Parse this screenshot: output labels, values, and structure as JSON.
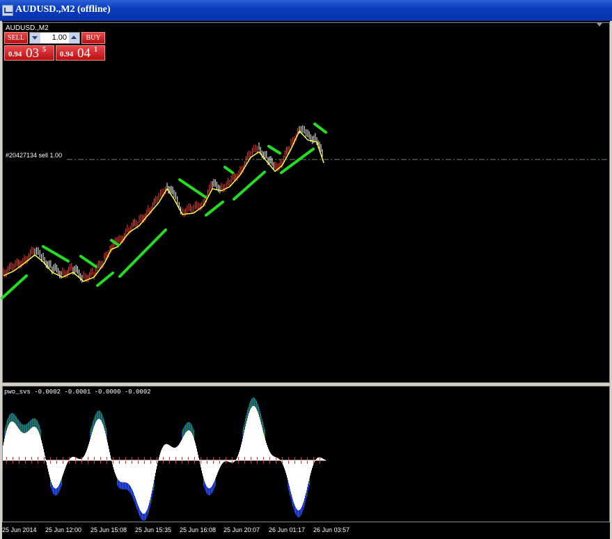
{
  "window": {
    "title": "AUDUSD.,M2 (offline)"
  },
  "chart": {
    "symbol_label": "AUDUSD.,M2"
  },
  "one_click": {
    "sell_label": "SELL",
    "buy_label": "BUY",
    "lot_value": "1.00",
    "sell_price": {
      "small": "0.94",
      "big": "03",
      "sup": "5"
    },
    "buy_price": {
      "small": "0.94",
      "big": "04",
      "sup": "1"
    }
  },
  "order": {
    "label": "#20427134 sell 1.00"
  },
  "indicator": {
    "label": "pwo_svs -0.0002 -0.0001 -0.0000 -0.0002"
  },
  "time_axis": {
    "ticks": [
      "25 Jun 2014",
      "25 Jun 12:00",
      "25 Jun 15:08",
      "25 Jun 15:35",
      "25 Jun 16:08",
      "25 Jun 20:07",
      "26 Jun 01:17",
      "26 Jun 03:57"
    ]
  },
  "colors": {
    "ma": "#ffff44",
    "channel": "#22dd22",
    "candles_up": "#ff3b30",
    "candles_down": "#ffffff",
    "hist_pos": "#ffffff",
    "hist_green": "#1a8a1a",
    "hist_blue": "#2323ff",
    "hist_red": "#ff2020",
    "order_line": "#6b8f5f"
  },
  "icons": {
    "app": "chart-app-icon",
    "corner": "chevron-down-icon"
  }
}
